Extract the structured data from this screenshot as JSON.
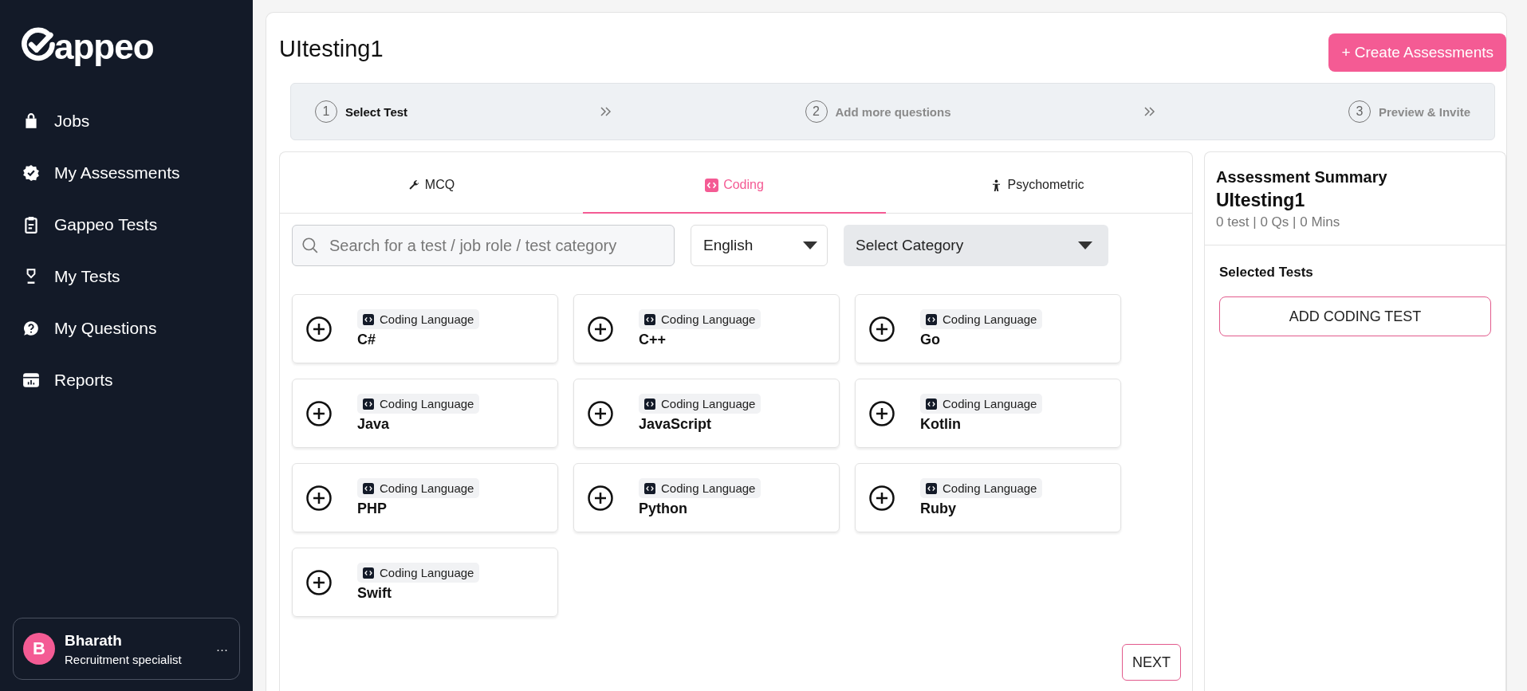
{
  "sidebar": {
    "logo": "appeo",
    "items": [
      {
        "label": "Jobs"
      },
      {
        "label": "My Assessments"
      },
      {
        "label": "Gappeo Tests"
      },
      {
        "label": "My Tests"
      },
      {
        "label": "My Questions"
      },
      {
        "label": "Reports"
      }
    ],
    "user": {
      "initial": "B",
      "name": "Bharath",
      "role": "Recruitment specialist",
      "menu": "···"
    }
  },
  "header": {
    "title": "UItesting1",
    "create_button": "+ Create Assessments"
  },
  "steps": [
    {
      "number": "1",
      "label": "Select Test",
      "selected": true
    },
    {
      "number": "2",
      "label": "Add more questions",
      "selected": false
    },
    {
      "number": "3",
      "label": "Preview & Invite",
      "selected": false
    }
  ],
  "tabs": [
    {
      "label": "MCQ",
      "selected": false
    },
    {
      "label": "Coding",
      "selected": true
    },
    {
      "label": "Psychometric",
      "selected": false
    }
  ],
  "filters": {
    "search": {
      "placeholder": "Search for a test / job role / test category"
    },
    "language": "English",
    "category": "Select Category"
  },
  "tests": [
    {
      "category": "Coding Language",
      "name": "C#"
    },
    {
      "category": "Coding Language",
      "name": "C++"
    },
    {
      "category": "Coding Language",
      "name": "Go"
    },
    {
      "category": "Coding Language",
      "name": "Java"
    },
    {
      "category": "Coding Language",
      "name": "JavaScript"
    },
    {
      "category": "Coding Language",
      "name": "Kotlin"
    },
    {
      "category": "Coding Language",
      "name": "PHP"
    },
    {
      "category": "Coding Language",
      "name": "Python"
    },
    {
      "category": "Coding Language",
      "name": "Ruby"
    },
    {
      "category": "Coding Language",
      "name": "Swift"
    }
  ],
  "next_button": "NEXT",
  "summary": {
    "title": "Assessment Summary",
    "name": "UItesting1",
    "stats": "0 test | 0 Qs | 0 Mins",
    "section": "Selected Tests",
    "add_button": "ADD CODING TEST"
  }
}
